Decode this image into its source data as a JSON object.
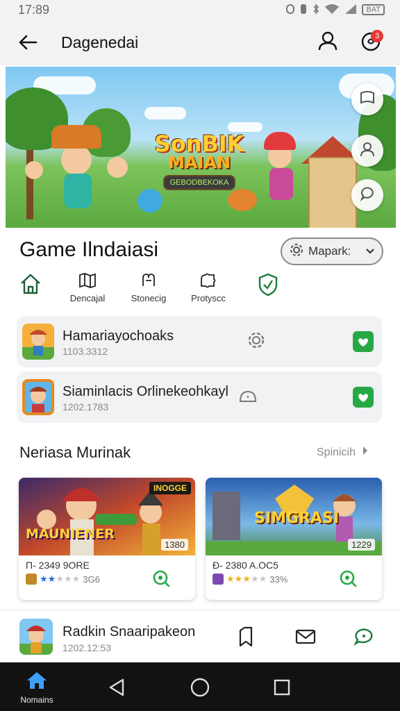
{
  "status_bar": {
    "time": "17:89",
    "icons": [
      "alarm-icon",
      "vibrate-icon",
      "bluetooth-icon",
      "wifi-icon",
      "signal-icon",
      "battery-icon"
    ],
    "battery": "BAT"
  },
  "app_bar": {
    "title": "Dagenedai",
    "notification_count": "3",
    "icons": [
      "back-arrow-icon",
      "user-icon",
      "notification-icon"
    ]
  },
  "hero": {
    "logo_line1": "SonBIK",
    "logo_line2": "MAIAN",
    "logo_line3": "GEBODBEKOKA",
    "side_buttons": [
      "bookmark-icon",
      "profile-icon",
      "chat-icon"
    ]
  },
  "section": {
    "title": "Game Ilndaiasi",
    "filter_label": "Mapark:",
    "categories": [
      {
        "label": "",
        "icon": "home-icon"
      },
      {
        "label": "Dencajal",
        "icon": "map-icon"
      },
      {
        "label": "Stonecig",
        "icon": "controller-icon"
      },
      {
        "label": "Protyscc",
        "icon": "puzzle-icon"
      },
      {
        "label": "",
        "icon": "shield-check-icon"
      }
    ]
  },
  "list": [
    {
      "name": "Hamariayochoaks",
      "sub": "1103.3312",
      "mid_icon": "gear-icon",
      "status": "checked"
    },
    {
      "name": "Siaminlacis Orlinekeohkayl",
      "sub": "1202.1783",
      "mid_icon": "cloud-icon",
      "status": "checked"
    }
  ],
  "featured": {
    "title": "Neriasa Murinak",
    "more_label": "Spinicih",
    "cards": [
      {
        "badge": "INOGGE",
        "art_title": "MAUNIENER",
        "count": "1380",
        "meta": "Π- 2349 9ORE",
        "rating_text": "3G6",
        "rating_stars": "★★★★★"
      },
      {
        "badge": "",
        "art_title": "SIMGRASI",
        "count": "1229",
        "meta": "Đ- 2380 A.OC5",
        "rating_text": "33%",
        "rating_stars": "★★★★★"
      }
    ]
  },
  "bottom_item": {
    "name": "Radkin Snaaripakeon",
    "sub": "1202.12:53",
    "actions": [
      "bookmark-icon",
      "mail-icon",
      "chat-icon"
    ]
  },
  "system_nav": {
    "home_label": "Nomains"
  },
  "colors": {
    "accent_green": "#27a844",
    "badge_red": "#e53935",
    "nav_blue": "#3ea0f5"
  }
}
